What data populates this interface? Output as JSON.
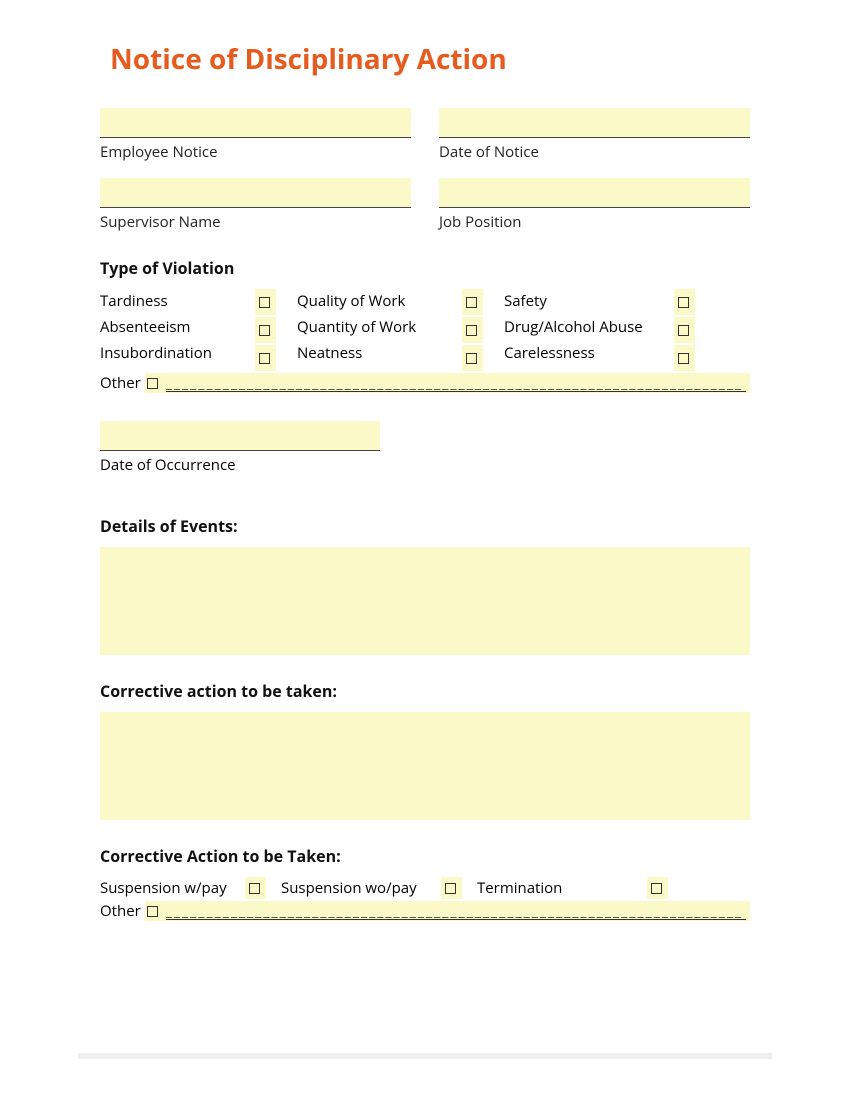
{
  "title": "Notice of Disciplinary Action",
  "fields": {
    "employee_notice": "Employee Notice",
    "date_of_notice": "Date of Notice",
    "supervisor_name": "Supervisor Name",
    "job_position": "Job Position",
    "date_of_occurrence": "Date of Occurrence"
  },
  "sections": {
    "type_of_violation": "Type of Violation",
    "details_of_events": "Details of Events:",
    "corrective_action_text": "Corrective action to be taken:",
    "corrective_action_checks": "Corrective Action to be Taken:"
  },
  "violations": {
    "tardiness": "Tardiness",
    "absenteeism": "Absenteeism",
    "insubordination": "Insubordination",
    "quality_of_work": "Quality of Work",
    "quantity_of_work": "Quantity of Work",
    "neatness": "Neatness",
    "safety": "Safety",
    "drug_alcohol": "Drug/Alcohol Abuse",
    "carelessness": "Carelessness",
    "other": "Other"
  },
  "corrective": {
    "suspension_w_pay": "Suspension w/pay",
    "suspension_wo_pay": "Suspension wo/pay",
    "termination": "Termination",
    "other": "Other"
  },
  "underline": "_______________________________________________________________________"
}
